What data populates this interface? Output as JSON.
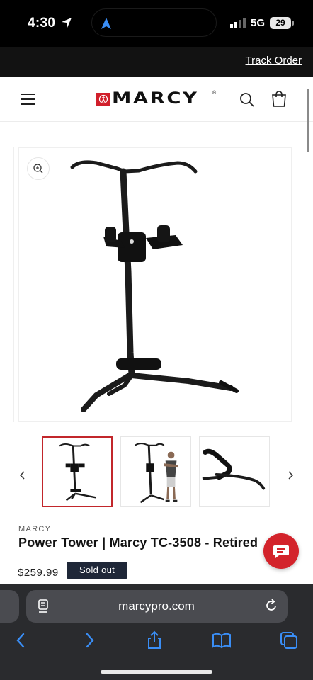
{
  "status_bar": {
    "time": "4:30",
    "network": "5G",
    "battery": "29"
  },
  "announcement": {
    "track_order": "Track Order"
  },
  "header": {
    "brand": "MARCY",
    "icons": [
      "menu-icon",
      "search-icon",
      "cart-icon"
    ]
  },
  "product": {
    "vendor": "MARCY",
    "title": "Power Tower | Marcy TC-3508 - Retired",
    "price": "$259.99",
    "badge": "Sold out"
  },
  "gallery": {
    "thumbnail_count": 3,
    "active_thumbnail": 1
  },
  "browser": {
    "url": "marcypro.com"
  },
  "colors": {
    "brand_red": "#d11f2b",
    "badge_bg": "#1f2738",
    "safari_blue": "#3a8ef6",
    "chat_red": "#d3232b"
  }
}
